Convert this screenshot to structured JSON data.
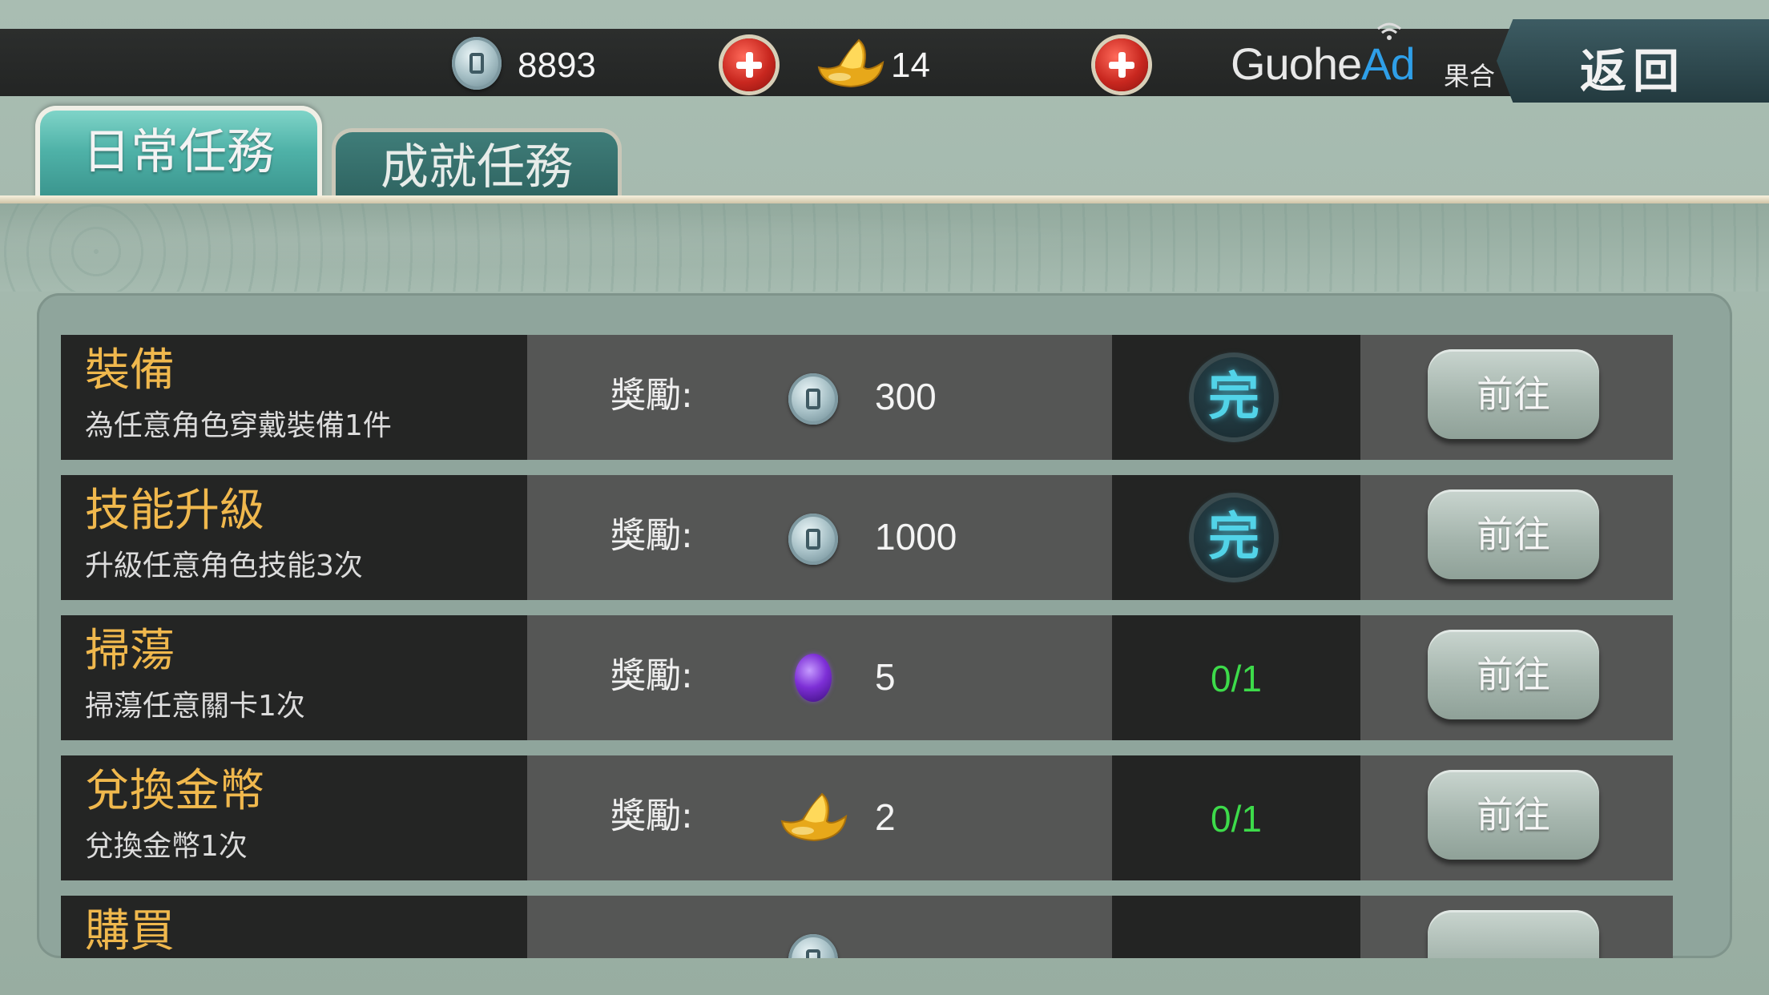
{
  "topbar": {
    "coins": "8893",
    "gold": "14",
    "logo": {
      "text_main": "Guohe",
      "text_ad": "Ad",
      "text_cn": "果合"
    },
    "back_label": "返回"
  },
  "tabs": [
    {
      "label": "日常任務",
      "active": true
    },
    {
      "label": "成就任務",
      "active": false
    }
  ],
  "tasks": [
    {
      "title": "裝備",
      "desc": "為任意角色穿戴裝備1件",
      "reward_label": "獎勵:",
      "reward_icon": "coin-icon",
      "reward_amount": "300",
      "status": "done",
      "status_text": "完",
      "go_label": "前往"
    },
    {
      "title": "技能升級",
      "desc": "升級任意角色技能3次",
      "reward_label": "獎勵:",
      "reward_icon": "coin-icon",
      "reward_amount": "1000",
      "status": "done",
      "status_text": "完",
      "go_label": "前往"
    },
    {
      "title": "掃蕩",
      "desc": "掃蕩任意關卡1次",
      "reward_label": "獎勵:",
      "reward_icon": "gem-icon",
      "reward_amount": "5",
      "status": "progress",
      "status_text": "0/1",
      "go_label": "前往"
    },
    {
      "title": "兌換金幣",
      "desc": "兌換金幣1次",
      "reward_label": "獎勵:",
      "reward_icon": "gold-ingot-icon",
      "reward_amount": "2",
      "status": "progress",
      "status_text": "0/1",
      "go_label": "前往"
    },
    {
      "title": "購買"
    }
  ],
  "colors": {
    "task_title": "#f0b84d",
    "progress_text": "#3ddb4a",
    "done_badge": "#52d3e8",
    "tab_active": "#4fb2a8"
  }
}
